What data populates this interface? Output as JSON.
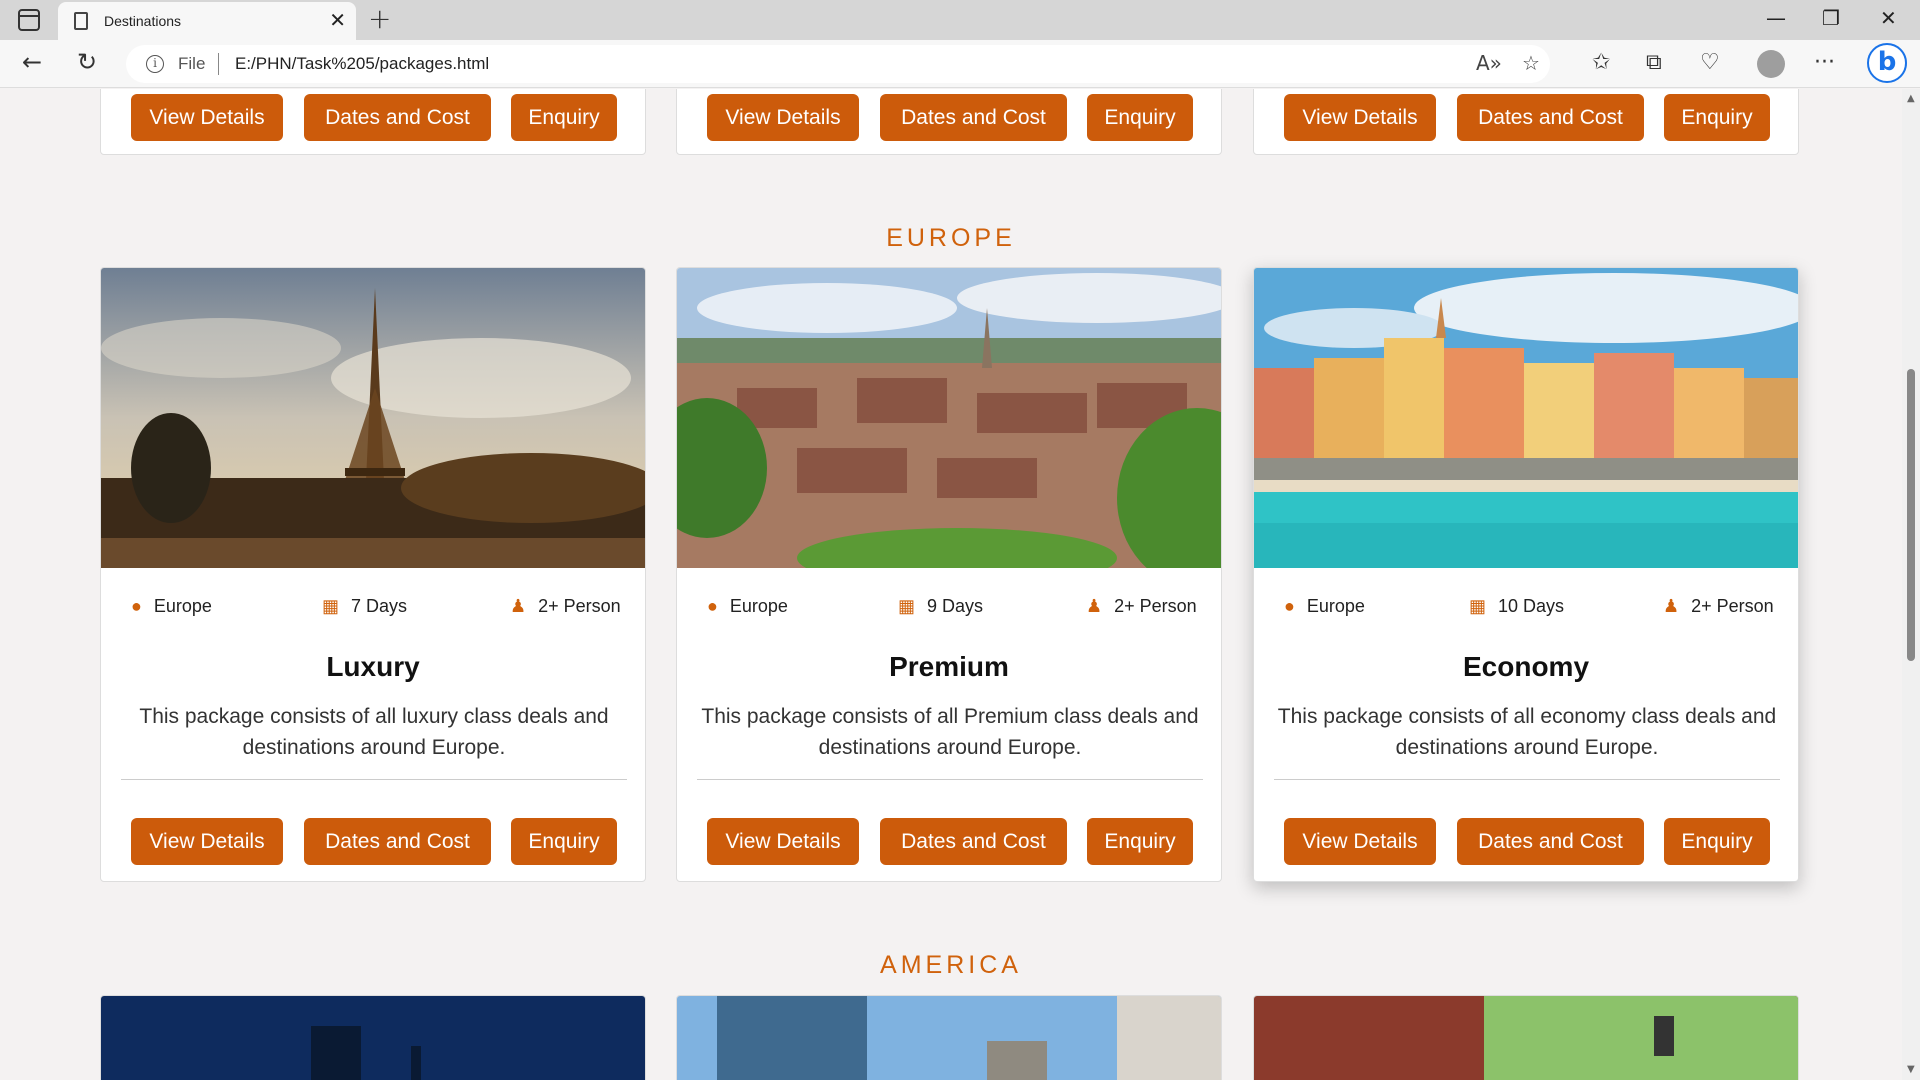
{
  "browser": {
    "tab_title": "Destinations",
    "file_label": "File",
    "url": "E:/PHN/Task%205/packages.html",
    "colors": {
      "accent": "#cc5b0b",
      "heading": "#d0620c"
    }
  },
  "buttons": {
    "view_details": "View Details",
    "dates_cost": "Dates and Cost",
    "enquiry": "Enquiry"
  },
  "sections": {
    "europe": {
      "heading": "EUROPE",
      "cards": [
        {
          "location": "Europe",
          "days": "7 Days",
          "persons": "2+ Person",
          "title": "Luxury",
          "description": "This package consists of all luxury class deals and destinations around Europe.",
          "image": "eiffel-tower-photo"
        },
        {
          "location": "Europe",
          "days": "9 Days",
          "persons": "2+ Person",
          "title": "Premium",
          "description": "This package consists of all Premium class deals and destinations around Europe.",
          "image": "bern-old-town-photo"
        },
        {
          "location": "Europe",
          "days": "10 Days",
          "persons": "2+ Person",
          "title": "Economy",
          "description": "This package consists of all economy class deals and destinations around Europe.",
          "image": "menton-coast-photo"
        }
      ]
    },
    "america": {
      "heading": "AMERICA"
    }
  },
  "icons": {
    "location": "map-pin-icon",
    "duration": "calendar-icon",
    "persons": "people-icon"
  }
}
